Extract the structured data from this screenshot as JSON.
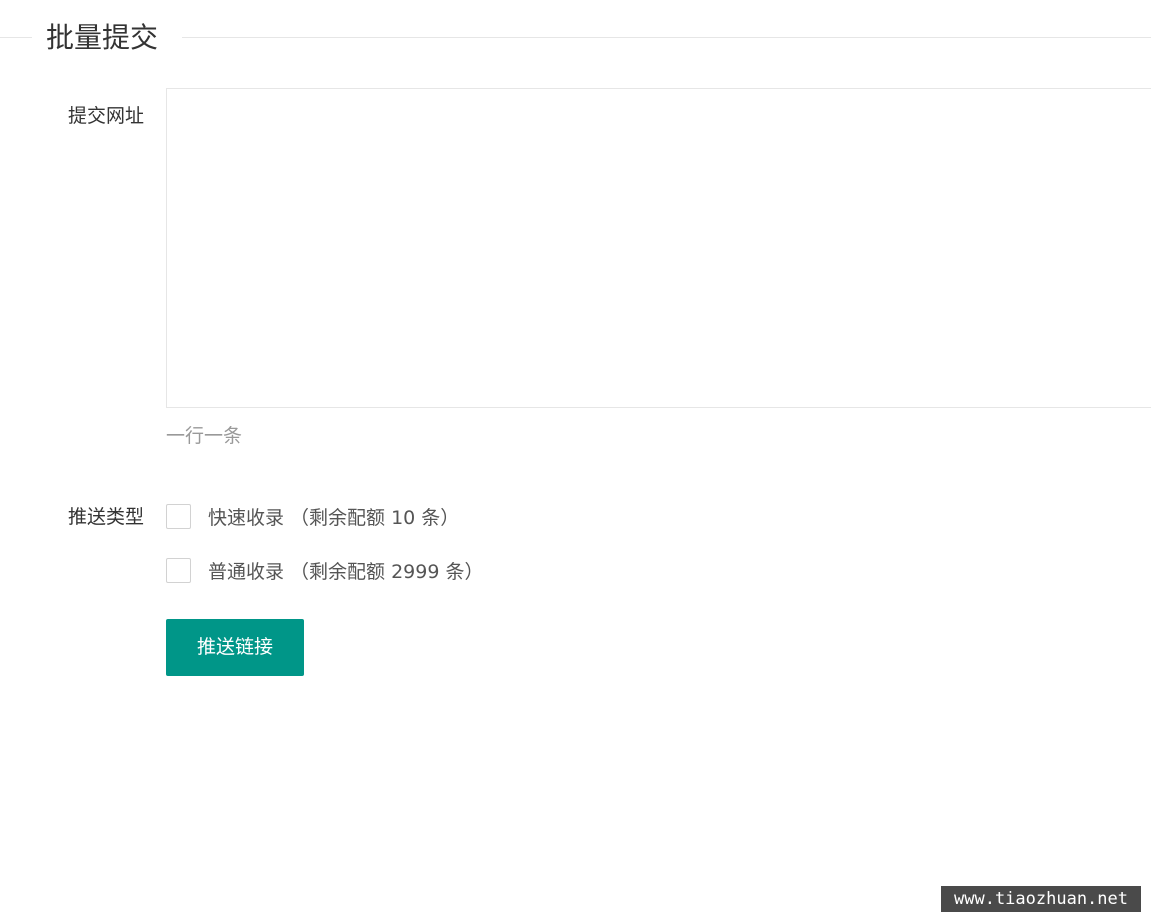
{
  "section": {
    "title": "批量提交"
  },
  "url_field": {
    "label": "提交网址",
    "value": "",
    "placeholder": "",
    "hint": "一行一条"
  },
  "push_type": {
    "label": "推送类型",
    "options": [
      {
        "label": "快速收录 （剩余配额 10 条）",
        "checked": false
      },
      {
        "label": "普通收录 （剩余配额 2999 条）",
        "checked": false
      }
    ]
  },
  "submit": {
    "label": "推送链接"
  },
  "watermark": {
    "text": "www.tiaozhuan.net"
  },
  "colors": {
    "primary": "#009688",
    "border": "#e6e6e6",
    "hint": "#999999",
    "text": "#333333"
  }
}
